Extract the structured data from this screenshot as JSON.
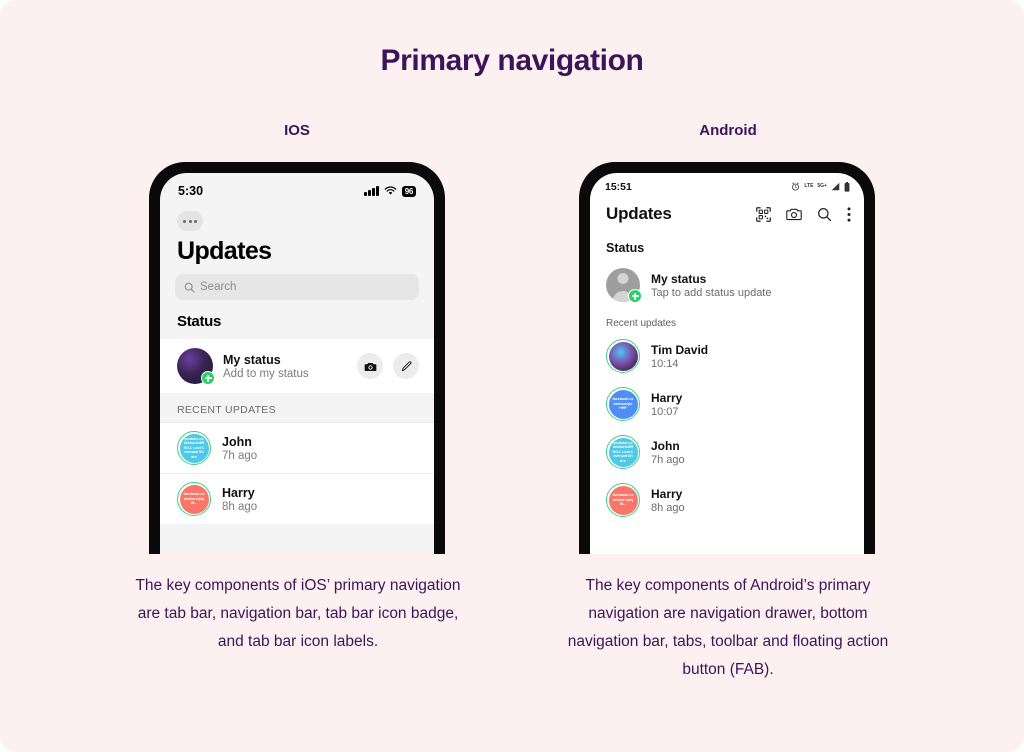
{
  "slide": {
    "title": "Primary navigation",
    "accent_color": "#3b1459",
    "background_color": "#fdf0f0"
  },
  "columns": [
    {
      "label": "IOS",
      "caption": "The key components of iOS’ primary navigation are tab bar, navigation bar, tab bar icon badge, and tab bar icon labels."
    },
    {
      "label": "Android",
      "caption": "The key components of Android’s primary navigation are navigation drawer, bottom navigation bar, tabs, toolbar and floating action button (FAB)."
    }
  ],
  "ios": {
    "statusbar": {
      "time": "5:30",
      "signal_icon": "cellular-signal-icon",
      "wifi_icon": "wifi-icon",
      "battery_level": "96"
    },
    "more_button_icon": "ellipsis-icon",
    "title": "Updates",
    "search": {
      "placeholder": "Search",
      "icon": "search-icon"
    },
    "section_title": "Status",
    "my_status": {
      "name": "My status",
      "subtitle": "Add to my status",
      "add_badge_icon": "plus-badge-icon",
      "camera_button_icon": "camera-icon",
      "edit_button_icon": "pencil-icon"
    },
    "recent_header": "RECENT UPDATES",
    "recent": [
      {
        "name": "John",
        "time": "7h ago",
        "avatar_color": "#4ec9e8",
        "avatar_text": "youtube.com/shorts/ff5NOJ- Lost Covenant Share"
      },
      {
        "name": "Harry",
        "time": "8h ago",
        "avatar_color": "#f9766a",
        "avatar_text": "facebook.com/share/p/qW..."
      }
    ]
  },
  "android": {
    "statusbar": {
      "time": "15:51",
      "alarm_icon": "alarm-icon",
      "lte_label": "LTE",
      "network_label": "5G+",
      "signal_icon": "cellular-signal-icon",
      "battery_icon": "battery-icon"
    },
    "title": "Updates",
    "toolbar_icons": [
      "qr-scan-icon",
      "camera-icon",
      "search-icon",
      "overflow-menu-icon"
    ],
    "section_title": "Status",
    "my_status": {
      "name": "My status",
      "subtitle": "Tap to add status update",
      "add_badge_icon": "plus-badge-icon"
    },
    "recent_header": "Recent updates",
    "recent": [
      {
        "name": "Tim David",
        "time": "10:14",
        "avatar_color": "#2f1f4a",
        "avatar_text": ""
      },
      {
        "name": "Harry",
        "time": "10:07",
        "avatar_color": "#4f8ef7",
        "avatar_text": "facebook.com/share/p/rHHF"
      },
      {
        "name": "John",
        "time": "7h ago",
        "avatar_color": "#4ec9e8",
        "avatar_text": "youtube.com/shorts/ff5NOJ- Lost Covenant Share"
      },
      {
        "name": "Harry",
        "time": "8h ago",
        "avatar_color": "#f9766a",
        "avatar_text": "facebook.com/share/p/qW..."
      }
    ]
  }
}
